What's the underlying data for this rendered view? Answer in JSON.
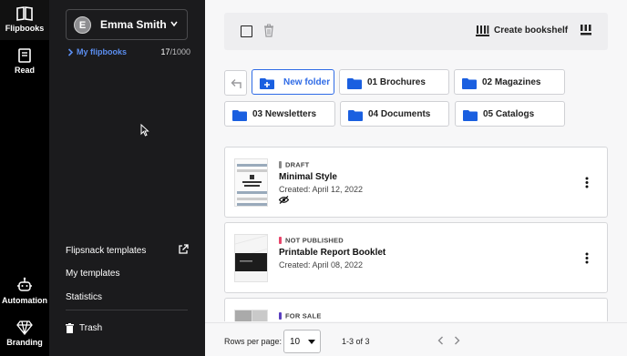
{
  "rail": {
    "flipbooks": "Flipbooks",
    "read": "Read",
    "automation": "Automation",
    "branding": "Branding"
  },
  "sidebar": {
    "account_initial": "E",
    "account_name": "Emma Smith",
    "my_flipbooks": "My flipbooks",
    "count_used": "17",
    "count_total": "/1000",
    "flipsnack_templates": "Flipsnack templates",
    "my_templates": "My templates",
    "statistics": "Statistics",
    "trash": "Trash"
  },
  "toolbar": {
    "create_bookshelf": "Create bookshelf"
  },
  "folders": {
    "new_folder": "New folder",
    "items": [
      "01 Brochures",
      "02 Magazines",
      "03 Newsletters",
      "04 Documents",
      "05 Catalogs"
    ]
  },
  "flipbooks": [
    {
      "status": "DRAFT",
      "status_color": "#8a8a8a",
      "title": "Minimal Style",
      "date": "Created: April 12, 2022"
    },
    {
      "status": "NOT PUBLISHED",
      "status_color": "#e8456b",
      "title": "Printable Report Booklet",
      "date": "Created: April 08, 2022"
    },
    {
      "status": "FOR SALE",
      "status_color": "#5a3fc0",
      "title": "",
      "date": ""
    }
  ],
  "footer": {
    "rows_label": "Rows per page:",
    "rows_value": "10",
    "range": "1-3 of 3"
  },
  "colors": {
    "accent": "#2f6be6",
    "folder": "#1a5fe0",
    "link": "#5b8ef0"
  }
}
